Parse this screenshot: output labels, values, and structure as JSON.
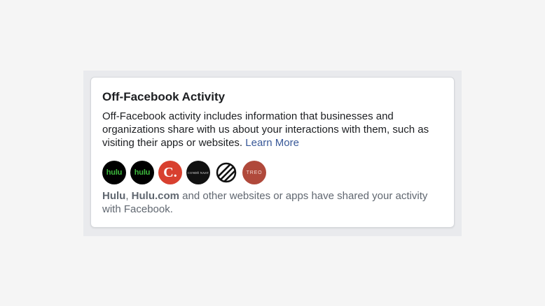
{
  "card": {
    "title": "Off-Facebook Activity",
    "description": "Off-Facebook activity includes information that businesses and organizations share with us about your interactions with them, such as visiting their apps or websites.",
    "learn_more": "Learn More",
    "apps": [
      {
        "name": "hulu-icon",
        "text": "hulu"
      },
      {
        "name": "hulu-icon",
        "text": "hulu"
      },
      {
        "name": "c-logo-icon",
        "text": "C."
      },
      {
        "name": "conde-nast-icon",
        "text": "CONDÉ NAST"
      },
      {
        "name": "stripe-circle-icon",
        "text": ""
      },
      {
        "name": "treo-icon",
        "text": "TREO"
      }
    ],
    "footer": {
      "site1": "Hulu",
      "sep": ", ",
      "site2": "Hulu.com",
      "rest": " and other websites or apps have shared your activity with Facebook."
    }
  },
  "colors": {
    "link": "#385898",
    "hulu_green": "#3dbb3d",
    "muted_text": "#606770"
  }
}
